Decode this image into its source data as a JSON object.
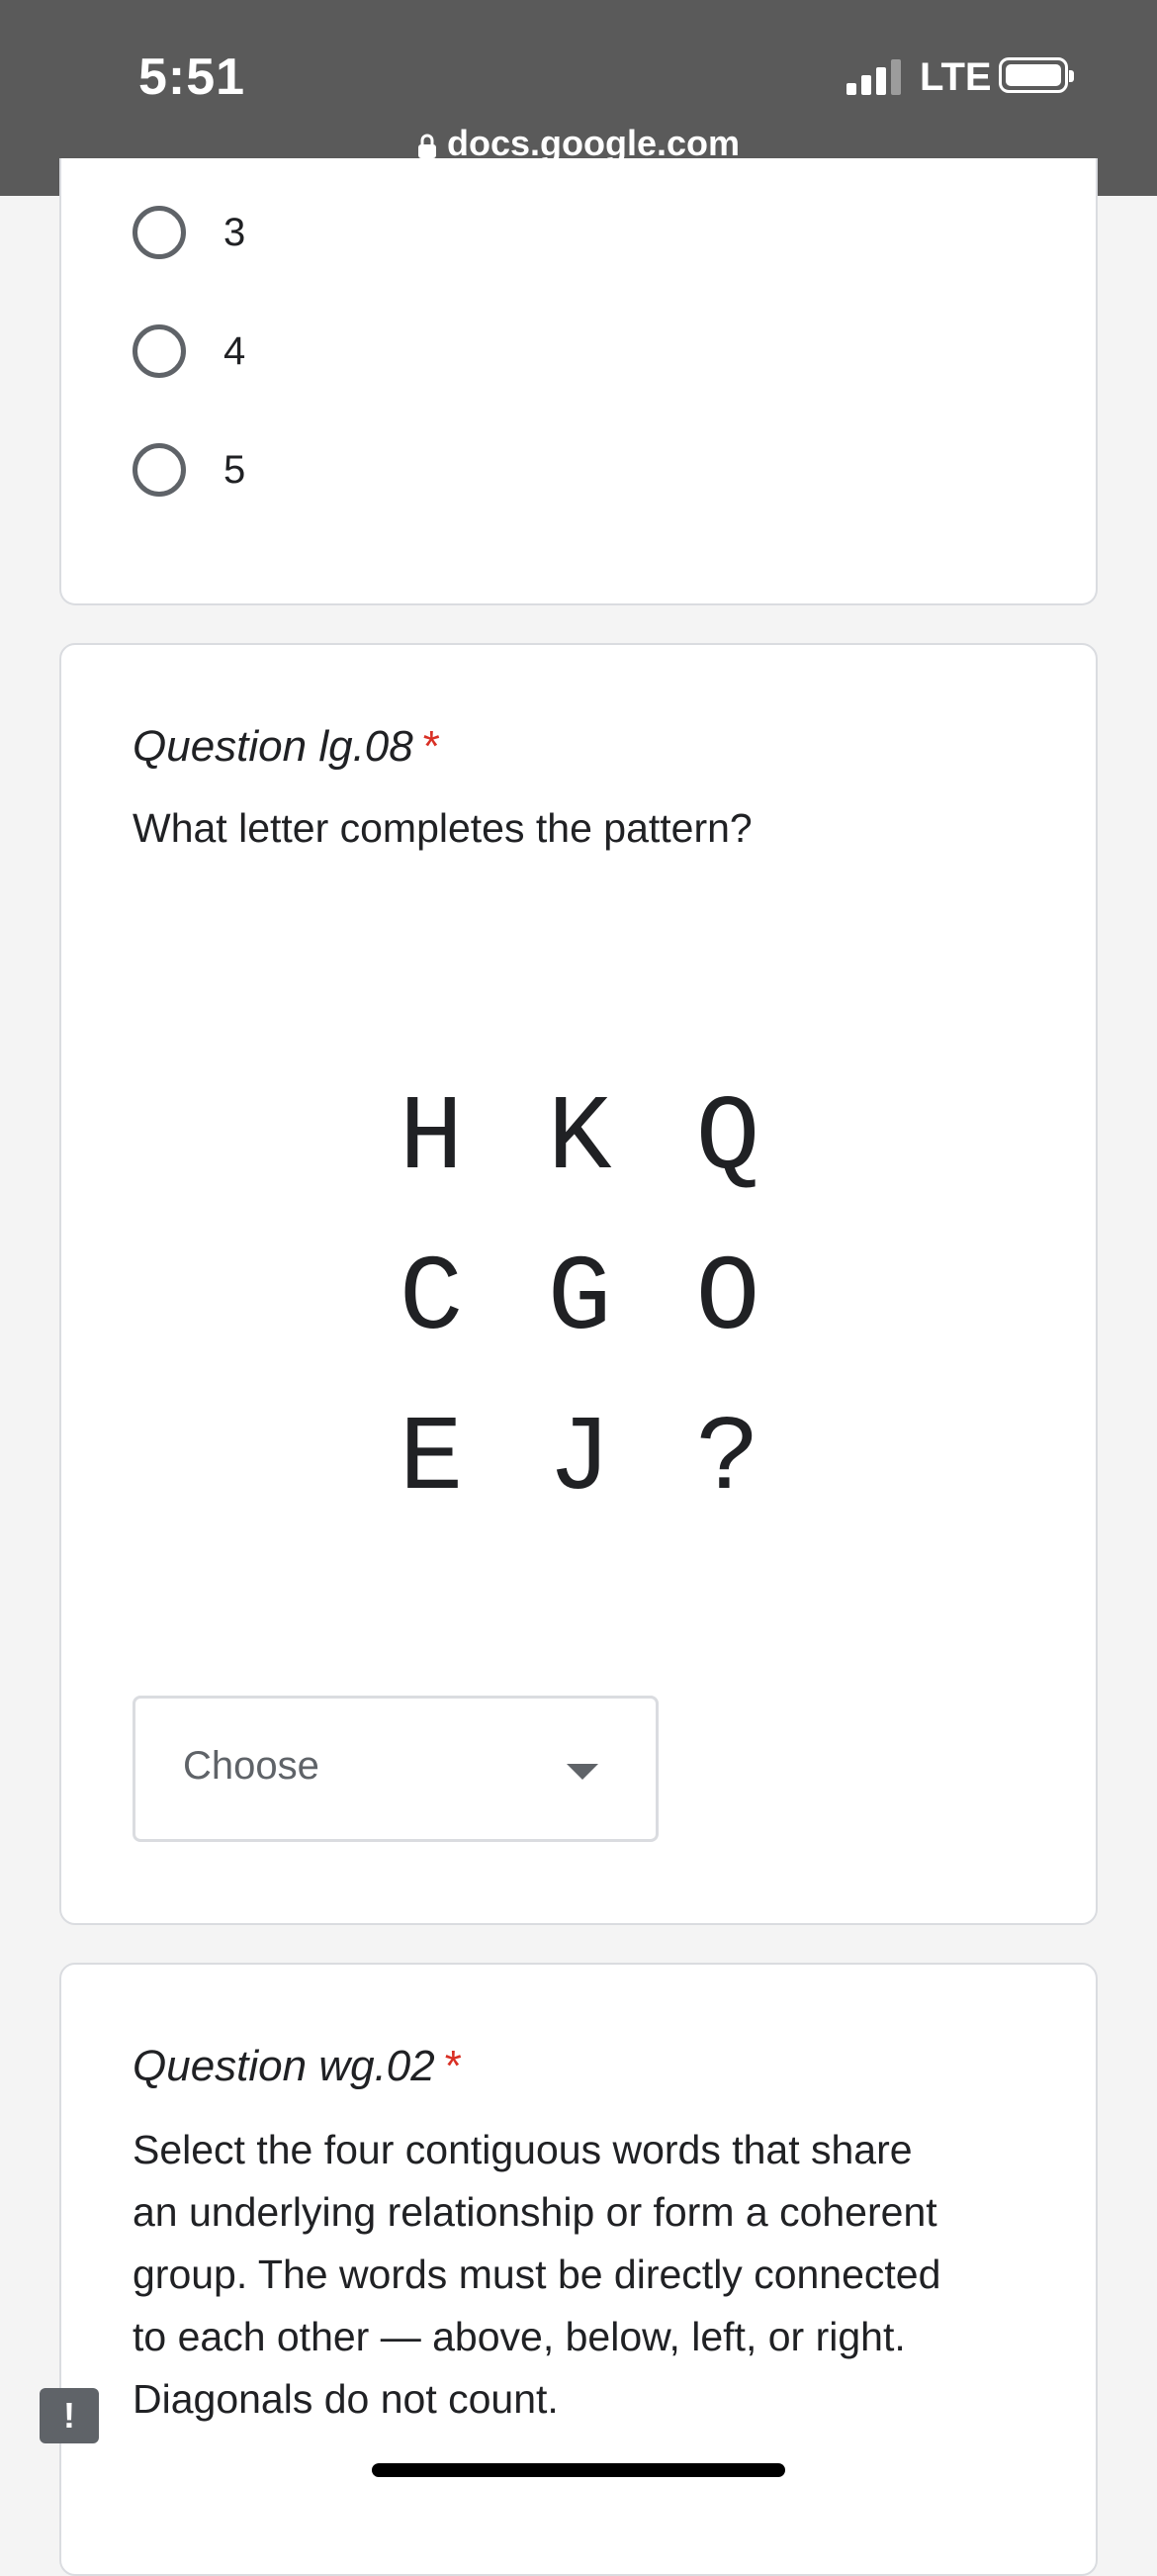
{
  "status_bar": {
    "time": "5:51",
    "network": "LTE",
    "url": "docs.google.com",
    "background_color": "#5a5a5a"
  },
  "previous_question": {
    "options": [
      "3",
      "4",
      "5"
    ]
  },
  "question_lg08": {
    "title": "Question lg.08",
    "required_mark": "*",
    "prompt": "What letter completes the pattern?",
    "grid": [
      [
        "H",
        "K",
        "Q"
      ],
      [
        "C",
        "G",
        "O"
      ],
      [
        "E",
        "J",
        "?"
      ]
    ],
    "dropdown_placeholder": "Choose"
  },
  "question_wg02": {
    "title": "Question wg.02",
    "required_mark": "*",
    "prompt_lines": [
      "Select the four contiguous words that share",
      "an underlying relationship or form a coherent",
      "group. The words must be directly connected",
      "to each other — above, below, left, or right.",
      "Diagonals do not count."
    ]
  },
  "report_button_label": "!",
  "colors": {
    "required": "#d93025",
    "card_border": "#dadce0",
    "page_background": "#f4f4f4"
  }
}
